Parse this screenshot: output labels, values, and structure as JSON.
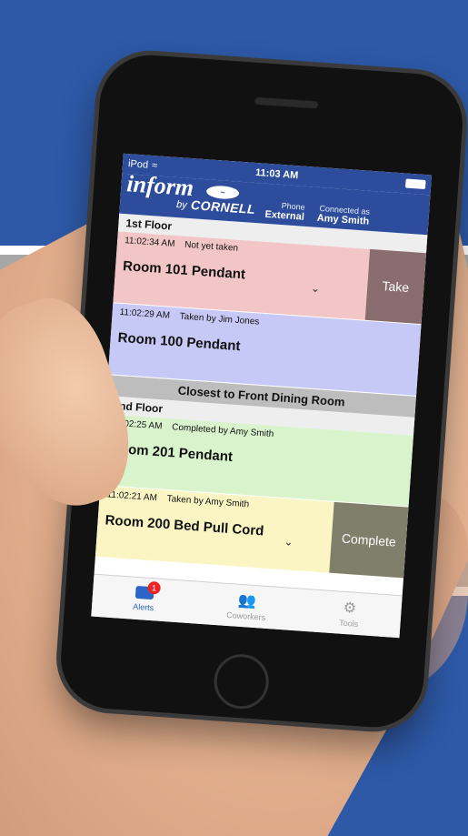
{
  "status_bar": {
    "carrier": "iPod",
    "time": "11:03 AM"
  },
  "header": {
    "brand_inform": "inform",
    "brand_by": "by",
    "brand_cornell": "CORNELL",
    "phone_label": "Phone",
    "phone_value": "External",
    "connected_label": "Connected as",
    "connected_value": "Amy Smith"
  },
  "floors": [
    {
      "name": "1st Floor",
      "alerts": [
        {
          "time": "11:02:34 AM",
          "status": "Not yet taken",
          "title": "Room 101 Pendant",
          "action": "Take",
          "color": "#f2c6c6",
          "action_color": "#8a6d6f"
        },
        {
          "time": "11:02:29 AM",
          "status": "Taken by Jim Jones",
          "title": "Room 100 Pendant",
          "color": "#c6c8f6"
        }
      ]
    },
    {
      "section_title": "Closest to Front Dining Room",
      "name": "2nd Floor",
      "alerts": [
        {
          "time": "11:02:25 AM",
          "status": "Completed by Amy Smith",
          "title": "Room 201 Pendant",
          "color": "#d9f4cc"
        },
        {
          "time": "11:02:21 AM",
          "status": "Taken by Amy Smith",
          "title": "Room 200 Bed Pull Cord",
          "action": "Complete",
          "color": "#fbf5c4",
          "action_color": "#7f7f6b"
        }
      ]
    }
  ],
  "tabs": [
    {
      "label": "Alerts",
      "badge": "1",
      "icon": "medkit-icon"
    },
    {
      "label": "Coworkers",
      "icon": "people-icon"
    },
    {
      "label": "Tools",
      "icon": "gear-icon"
    }
  ]
}
